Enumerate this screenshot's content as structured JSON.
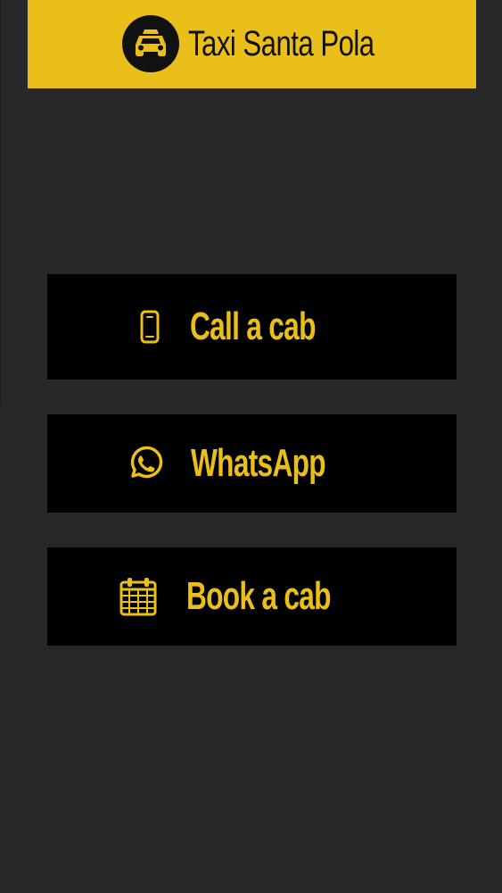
{
  "header": {
    "title": "Taxi Santa Pola",
    "logo_icon": "taxi-icon"
  },
  "actions": [
    {
      "label": "Call a cab",
      "icon": "phone-icon"
    },
    {
      "label": "WhatsApp",
      "icon": "whatsapp-icon"
    },
    {
      "label": "Book a cab",
      "icon": "calendar-icon"
    }
  ],
  "colors": {
    "accent": "#eabf1a",
    "background": "#28282a",
    "button": "#000000",
    "header_text": "#111111"
  }
}
